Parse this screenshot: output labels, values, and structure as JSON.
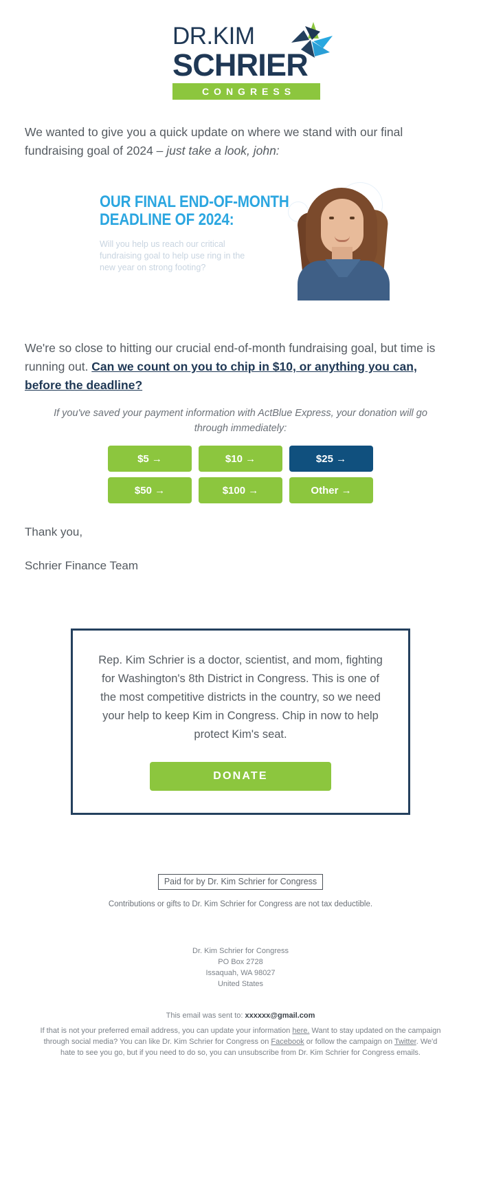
{
  "logo": {
    "line1": "DR.KIM",
    "line2": "SCHRIER",
    "banner": "CONGRESS",
    "star_icon": "multicolor-star-icon",
    "colors": {
      "navy": "#1f3855",
      "green": "#8cc63e",
      "light_blue": "#2ba6e0"
    }
  },
  "intro": {
    "text_part1": "We wanted to give you a quick update on where we stand with our final fundraising goal of 2024 ",
    "text_italic": "– just take a look, john:"
  },
  "hero": {
    "headline_line1": "OUR FINAL END-OF-MONTH",
    "headline_line2": "DEADLINE OF 2024:",
    "subtext": "Will you help us reach our critical fundraising goal to help use ring in the new year on strong footing?",
    "photo_alt": "portrait-of-kim-schrier",
    "bg_color": "#24405e",
    "headline_color": "#2ba6e0"
  },
  "ask": {
    "line_part1": "We're so close to hitting our crucial end-of-month fundraising goal, but time is running out. ",
    "link_text": "Can we count on you to chip in $10, or anything you can, before the deadline?",
    "express_note": "If you've saved your payment information with ActBlue Express, your donation will go through immediately:"
  },
  "buttons": {
    "row1": [
      {
        "label": "$5 →",
        "style": "green"
      },
      {
        "label": "$10 →",
        "style": "green"
      },
      {
        "label": "$25 →",
        "style": "navy"
      }
    ],
    "row2": [
      {
        "label": "$50 →",
        "style": "green"
      },
      {
        "label": "$100 →",
        "style": "green"
      },
      {
        "label": "Other →",
        "style": "green"
      }
    ]
  },
  "signoff": {
    "thanks": "Thank you,",
    "team": "Schrier Finance Team"
  },
  "callout": {
    "body": "Rep. Kim Schrier is a doctor, scientist, and mom, fighting for Washington's 8th District in Congress. This is one of the most competitive districts in the country, so we need your help to keep Kim in Congress. Chip in now to help protect Kim's seat.",
    "donate_label": "DONATE"
  },
  "footer": {
    "paid_for": "Paid for by Dr. Kim Schrier for Congress",
    "tax_note": "Contributions or gifts to Dr. Kim Schrier for Congress are not tax deductible.",
    "address": [
      "Dr. Kim Schrier for Congress",
      "PO Box 2728",
      "Issaquah, WA 98027",
      "United States"
    ],
    "sent_to_prefix": "This email was sent to: ",
    "sent_to_email": "xxxxxx@gmail.com",
    "legal_1": "If that is not your preferred email address, you can update your information ",
    "legal_link_here": "here.",
    "legal_2": " Want to stay updated on the campaign through social media? You can like Dr. Kim Schrier for Congress on ",
    "legal_link_facebook": "Facebook",
    "legal_3": " or follow the campaign on ",
    "legal_link_twitter": "Twitter",
    "legal_4": ". We'd hate to see you go, but if you need to do so, you can unsubscribe from Dr. Kim Schrier for Congress emails."
  }
}
